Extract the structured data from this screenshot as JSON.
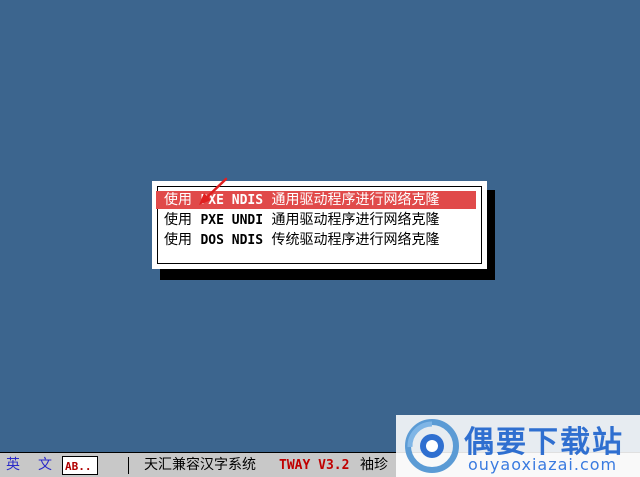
{
  "menu": {
    "items": [
      {
        "prefix": "使用 ",
        "keyword": "PXE NDIS",
        "suffix": " 通用驱动程序进行网络克隆",
        "selected": true
      },
      {
        "prefix": "使用 ",
        "keyword": "PXE UNDI",
        "suffix": " 通用驱动程序进行网络克隆",
        "selected": false
      },
      {
        "prefix": "使用 ",
        "keyword": "DOS NDIS",
        "suffix": " 传统驱动程序进行网络克隆",
        "selected": false
      }
    ]
  },
  "status_bar": {
    "lang1": "英",
    "lang2": "文",
    "mode": "AB..",
    "system_name": "天汇兼容汉字系统",
    "version": "TWAY V3.2",
    "input_method": "袖珍"
  },
  "watermark": {
    "title": "偶要下载站",
    "url": "ouyaoxiazai.com"
  },
  "colors": {
    "background": "#3c658e",
    "selection": "#e04a4a",
    "arrow": "#e02020"
  }
}
